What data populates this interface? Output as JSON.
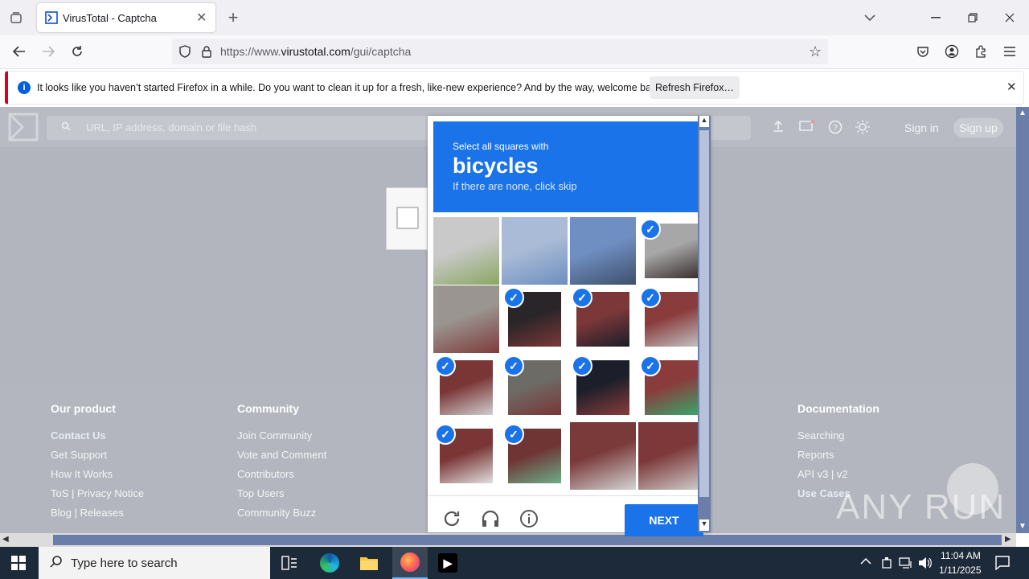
{
  "browser": {
    "tab_title": "VirusTotal - Captcha",
    "url_prefix": "https://www.",
    "url_domain": "virustotal.com",
    "url_path": "/gui/captcha",
    "notification_text": "It looks like you haven’t started Firefox in a while. Do you want to clean it up for a fresh, like-new experience? And by the way, welcome back!",
    "refresh_button": "Refresh Firefox…"
  },
  "vt": {
    "search_placeholder": "URL, IP address, domain or file hash",
    "sign_in": "Sign in",
    "sign_up": "Sign up"
  },
  "footer": {
    "col1": {
      "heading": "Our product",
      "links": [
        "Contact Us",
        "Get Support",
        "How It Works",
        "ToS | Privacy Notice",
        "Blog | Releases"
      ]
    },
    "col2": {
      "heading": "Community",
      "links": [
        "Join Community",
        "Vote and Comment",
        "Contributors",
        "Top Users",
        "Community Buzz"
      ]
    },
    "col3": {
      "heading": "Documentation",
      "links": [
        "Searching",
        "Reports",
        "API v3 | v2",
        "Use Cases"
      ]
    }
  },
  "captcha": {
    "instruction": "Select all squares with",
    "target": "bicycles",
    "subtext": "If there are none, click skip",
    "next_button": "NEXT",
    "tiles_selected": [
      false,
      false,
      false,
      true,
      false,
      true,
      true,
      true,
      true,
      true,
      true,
      true,
      true,
      true,
      false,
      false
    ]
  },
  "taskbar": {
    "search_placeholder": "Type here to search",
    "time": "11:04 AM",
    "date": "1/11/2025"
  },
  "watermark": "ANY RUN",
  "colors": {
    "accent": "#1a73e8",
    "overlay": "#b2b5bd"
  }
}
